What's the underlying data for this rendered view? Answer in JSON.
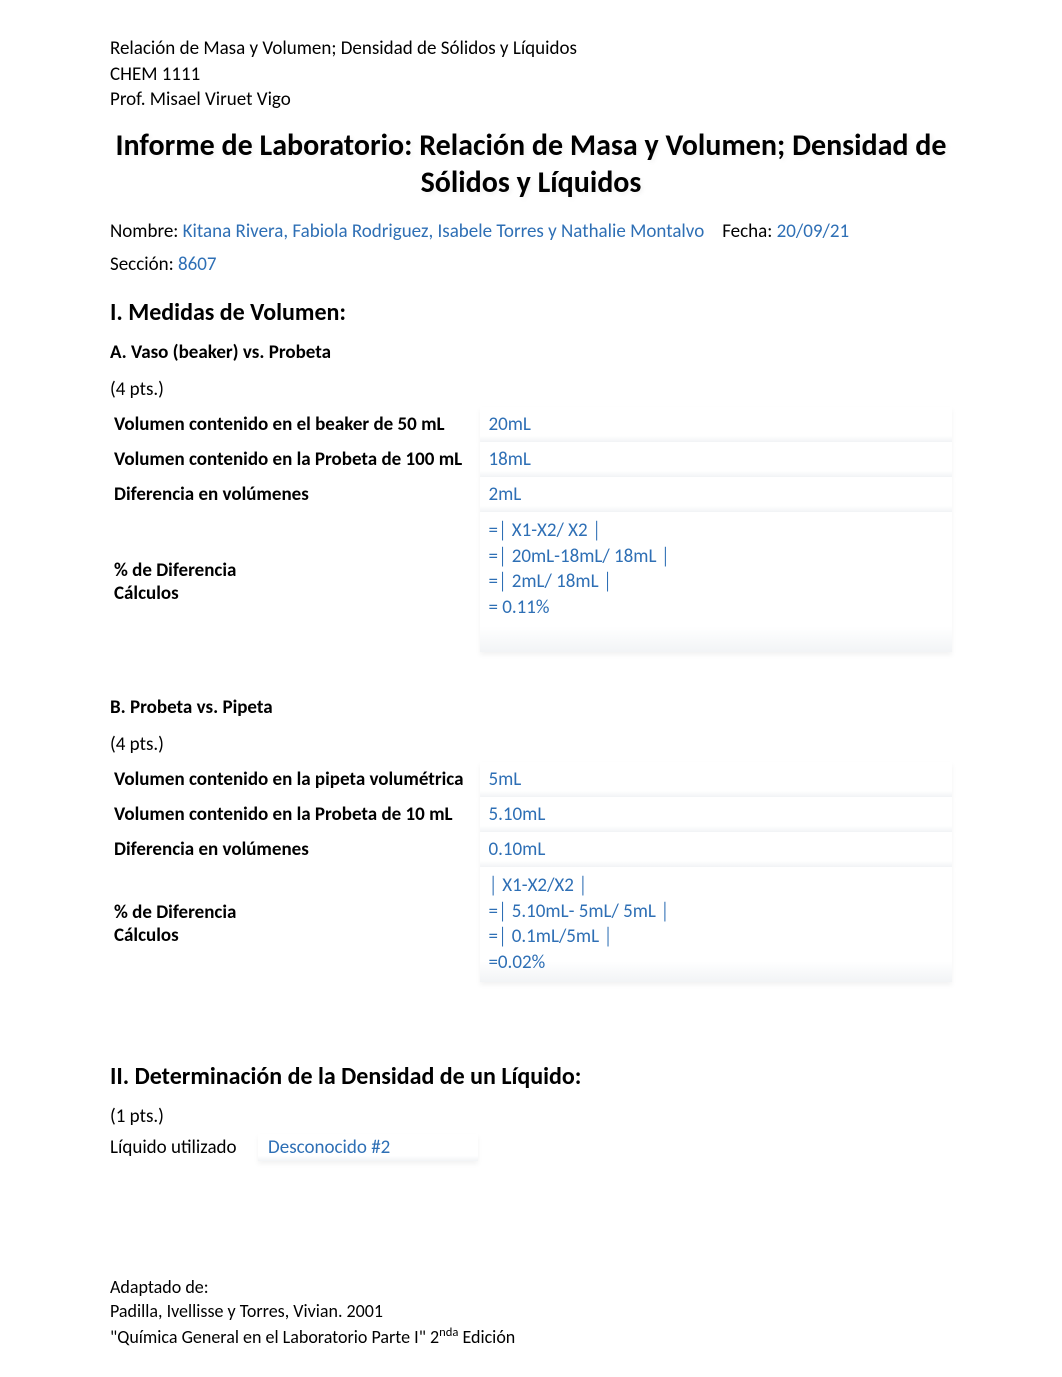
{
  "header": {
    "line1": "Relación de Masa y Volumen; Densidad de Sólidos y Líquidos",
    "line2": "CHEM 1111",
    "line3": "Prof. Misael Viruet Vigo"
  },
  "title": "Informe de Laboratorio: Relación de Masa y Volumen; Densidad de Sólidos y Líquidos",
  "info": {
    "nombre_label": "Nombre: ",
    "nombre_value": "Kitana Rivera, Fabiola Rodriguez, Isabele Torres y Nathalie Montalvo",
    "fecha_label": "Fecha: ",
    "fecha_value": "20/09/21",
    "seccion_label": "Sección: ",
    "seccion_value": "8607"
  },
  "section1": {
    "heading": "I. Medidas de Volumen:",
    "partA": {
      "heading": "A. Vaso (beaker) vs. Probeta",
      "pts": "(4 pts.)",
      "rows": [
        {
          "label": "Volumen contenido en el beaker de 50 mL",
          "value": "20mL"
        },
        {
          "label": "Volumen contenido en la Probeta de 100 mL",
          "value": "18mL"
        },
        {
          "label": "Diferencia en volúmenes",
          "value": "2mL"
        }
      ],
      "calc_label1": "% de Diferencia",
      "calc_label2": "Cálculos",
      "calc_lines": [
        "=│ X1-X2/ X2 │",
        "=│ 20mL-18mL/ 18mL │",
        "=│ 2mL/ 18mL │",
        "= 0.11%"
      ]
    },
    "partB": {
      "heading": "B. Probeta vs. Pipeta",
      "pts": "(4 pts.)",
      "rows": [
        {
          "label": "Volumen contenido en la pipeta volumétrica",
          "value": "5mL"
        },
        {
          "label": "Volumen contenido en la Probeta de 10 mL",
          "value": "5.10mL"
        },
        {
          "label": "Diferencia en volúmenes",
          "value": "0.10mL"
        }
      ],
      "calc_label1": "% de Diferencia",
      "calc_label2": "Cálculos",
      "calc_lines": [
        "│ X1-X2/X2 │",
        "=│ 5.10mL- 5mL/ 5mL │",
        "=│ 0.1mL/5mL │",
        "=0.02%"
      ]
    }
  },
  "section2": {
    "heading": "II. Determinación de la Densidad de un Líquido:",
    "pts": "(1 pts.)",
    "liquido_label": "Líquido utilizado",
    "liquido_value": "Desconocido #2"
  },
  "footer": {
    "line1": "Adaptado de:",
    "line2": "Padilla, Ivellisse y Torres, Vivian. 2001",
    "line3_pre": " \"Química General en el Laboratorio  Parte I\" 2",
    "line3_sup": "nda",
    "line3_post": "  Edición"
  }
}
